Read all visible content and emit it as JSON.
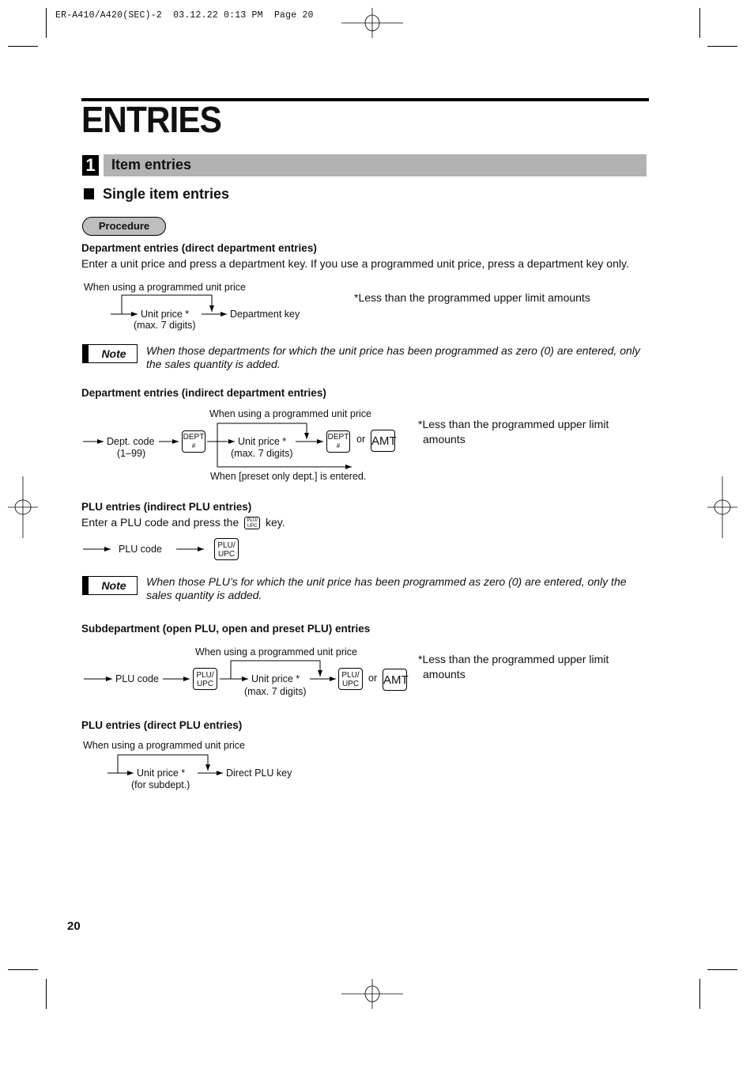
{
  "slug": "ER-A410/A420(SEC)-2  03.12.22 0:13 PM  Page 20",
  "title": "ENTRIES",
  "section": {
    "number": "1",
    "title": "Item entries"
  },
  "subsection": {
    "title": "Single item entries"
  },
  "procedure_label": "Procedure",
  "note_label": "Note",
  "dept_direct": {
    "heading": "Department entries (direct department entries)",
    "text": "Enter a unit price and press a department key.  If you use a programmed unit price, press a department key only.",
    "bypass_label": "When using a programmed unit price",
    "unit_price": "Unit price *",
    "unit_price_sub": "(max. 7 digits)",
    "dept_key": "Department key",
    "footnote": "*Less than the programmed upper limit amounts",
    "note": "When those departments for which the unit price has been programmed as zero (0) are entered, only the sales quantity is added."
  },
  "dept_indirect": {
    "heading": "Department entries (indirect department entries)",
    "bypass_label": "When using a programmed unit price",
    "dept_code": "Dept. code",
    "dept_code_sub": "(1–99)",
    "key_dept_top": "DEPT",
    "key_dept_bottom": "#",
    "unit_price": "Unit price *",
    "unit_price_sub": "(max. 7 digits)",
    "or": "or",
    "key_amt": "AMT",
    "preset_label": "When [preset only dept.] is entered.",
    "footnote_line1": "*Less than the programmed upper limit",
    "footnote_line2": "amounts"
  },
  "plu_indirect": {
    "heading": "PLU entries (indirect PLU entries)",
    "text_before": "Enter a PLU code and press the",
    "text_after": "key.",
    "plu_code": "PLU code",
    "key_plu_top": "PLU/",
    "key_plu_bottom": "UPC",
    "note": "When those PLU’s for which the unit price has been programmed as zero (0) are entered, only the sales quantity is added."
  },
  "subdept": {
    "heading": "Subdepartment (open PLU, open and preset PLU) entries",
    "bypass_label": "When using a programmed unit price",
    "plu_code": "PLU code",
    "key_plu_top": "PLU/",
    "key_plu_bottom": "UPC",
    "unit_price": "Unit price *",
    "unit_price_sub": "(max. 7 digits)",
    "or": "or",
    "key_amt": "AMT",
    "footnote_line1": "*Less than the programmed upper limit",
    "footnote_line2": "amounts"
  },
  "plu_direct": {
    "heading": "PLU entries (direct PLU entries)",
    "bypass_label": "When using a programmed unit price",
    "unit_price": "Unit price *",
    "unit_price_sub": "(for subdept.)",
    "direct_key": "Direct PLU key"
  },
  "page_number": "20"
}
